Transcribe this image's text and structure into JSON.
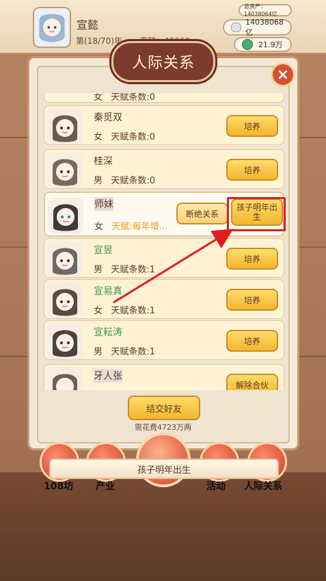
{
  "player": {
    "name": "宣懿",
    "year": "第(18/70)年",
    "reputation": "声望：49060"
  },
  "resources": {
    "total_assets": "总资产：14038064亿",
    "silver": "14038068亿",
    "jade": "21.9万"
  },
  "panel": {
    "title": "人际关系",
    "make_friend_label": "结交好友",
    "make_friend_cost": "需花费4723万两"
  },
  "list": {
    "rows": [
      {
        "name": "",
        "gender": "女",
        "talent": "天赋条数:0",
        "action": "培养"
      },
      {
        "name": "秦觅双",
        "gender": "女",
        "talent": "天赋条数:0",
        "action": "培养"
      },
      {
        "name": "桂深",
        "gender": "男",
        "talent": "天赋条数:0",
        "action": "培养"
      },
      {
        "name": "师妹",
        "gender": "女",
        "talent": "天赋:每年增...",
        "secondary_action": "断绝关系",
        "primary_action": "孩子明年出生"
      },
      {
        "name": "宣昱",
        "gender": "男",
        "talent": "天赋条数:1",
        "action": "培养"
      },
      {
        "name": "宣易真",
        "gender": "女",
        "talent": "天赋条数:1",
        "action": "培养"
      },
      {
        "name": "宣耘涛",
        "gender": "男",
        "talent": "天赋条数:1",
        "action": "培养"
      },
      {
        "name": "牙人张",
        "gender": "",
        "talent": "",
        "action": "解除合伙"
      }
    ]
  },
  "toast": {
    "text": "孩子明年出生"
  },
  "bottom_nav": {
    "items": [
      {
        "label": "108坊"
      },
      {
        "label": "产业"
      },
      {
        "label": "活动"
      },
      {
        "label": "人际关系"
      }
    ]
  },
  "colors": {
    "accent_green": "#3f9a4a",
    "accent_orange": "#ef9d22",
    "highlight_red": "#e11c1c",
    "button_gold": "#f4b52d",
    "banner_maroon": "#7b3b2d"
  },
  "icons": {
    "close": "close-icon",
    "silver": "silver-icon",
    "jade": "jade-icon"
  }
}
